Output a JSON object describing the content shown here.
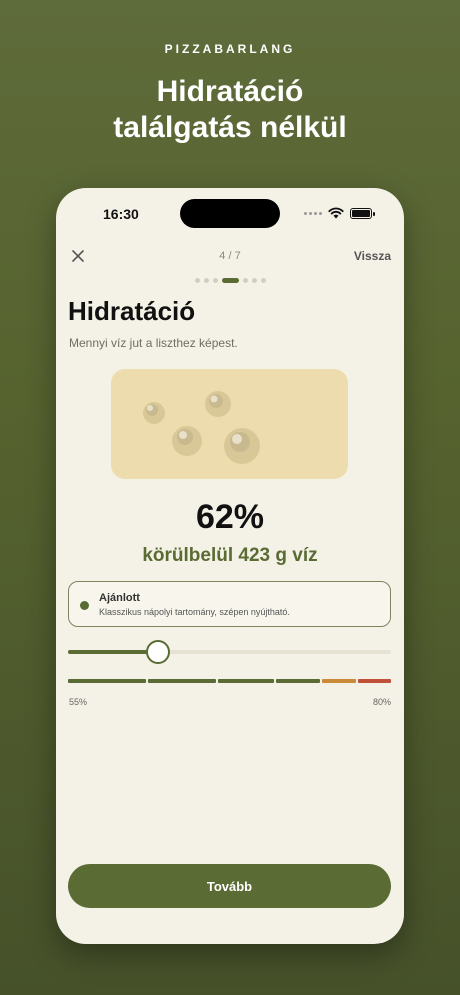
{
  "brand": "PIZZABARLANG",
  "headline": {
    "line1": "Hidratáció",
    "line2": "találgatás nélkül"
  },
  "status_bar": {
    "time": "16:30"
  },
  "nav": {
    "step": "4 / 7",
    "back_label": "Vissza",
    "total_steps": 7,
    "current_step": 4
  },
  "screen": {
    "title": "Hidratáció",
    "subtitle": "Mennyi víz jut a liszthez képest.",
    "hydration_percent": "62%",
    "water_amount": "körülbelül 423 g víz"
  },
  "recommendation": {
    "title": "Ajánlott",
    "description": "Klasszikus nápolyi tartomány, szépen nyújtható."
  },
  "slider": {
    "min_label": "55%",
    "max_label": "80%",
    "min": 55,
    "max": 80,
    "value": 62
  },
  "scale_colors": [
    "#5a6b34",
    "#5a6b34",
    "#5a6b34",
    "#5a6b34",
    "#c98a3a",
    "#c0503a"
  ],
  "next_button": "Tovább",
  "colors": {
    "accent": "#5a6b34",
    "background": "#f4f1e6",
    "dough": "#ecdcae"
  }
}
